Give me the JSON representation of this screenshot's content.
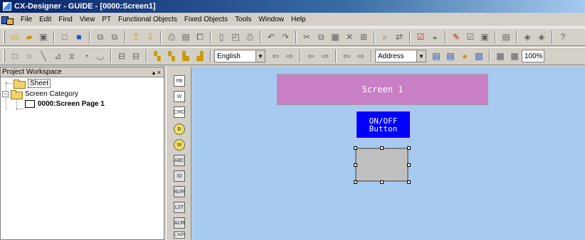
{
  "window": {
    "title": "CX-Designer - GUIDE - [0000:Screen1]"
  },
  "menu": {
    "items": [
      "File",
      "Edit",
      "Find",
      "View",
      "PT",
      "Functional Objects",
      "Fixed Objects",
      "Tools",
      "Window",
      "Help"
    ]
  },
  "toolbar2": {
    "language_value": "English",
    "address_value": "Address",
    "zoom_value": "100%"
  },
  "workspace": {
    "title": "Project Workspace",
    "controls": "▴ ×",
    "tree": {
      "sheet": "Sheet",
      "screen_category": "Screen Category",
      "screen_page": "0000:Screen Page 1"
    }
  },
  "object_toolbar": {
    "items": [
      "PB",
      "W",
      "CMD",
      "B",
      "W",
      "ABC",
      "IO",
      "NUM",
      "LST",
      "ALM",
      "LMP"
    ]
  },
  "canvas": {
    "screen_title": "Screen 1",
    "onoff_line1": "ON/OFF",
    "onoff_line2": "Button"
  },
  "colors": {
    "canvas_bg": "#a6caf0",
    "title_bg": "#c87fc5",
    "onoff_bg": "#0000ff"
  }
}
